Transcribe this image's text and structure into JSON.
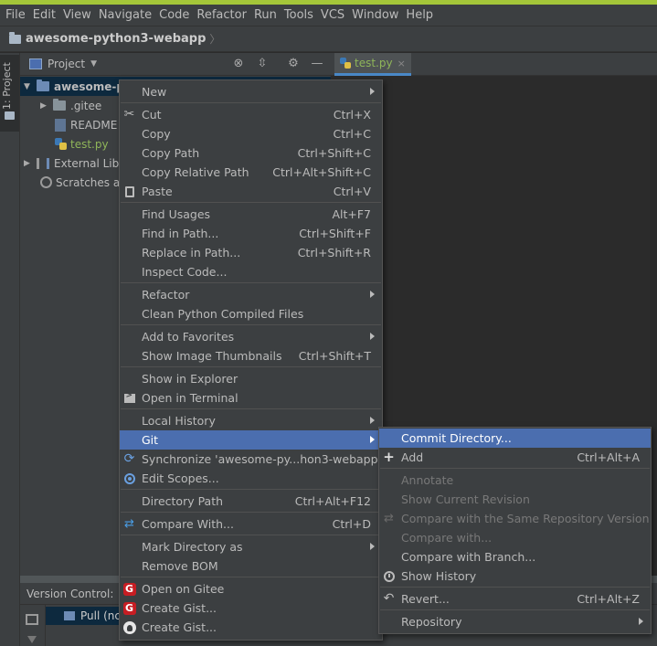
{
  "menubar": {
    "items": [
      "File",
      "Edit",
      "View",
      "Navigate",
      "Code",
      "Refactor",
      "Run",
      "Tools",
      "VCS",
      "Window",
      "Help"
    ]
  },
  "navbar": {
    "project_title": "awesome-python3-webapp",
    "chevron": "〉"
  },
  "toolstrip": {
    "project_label": "1: Project"
  },
  "project_panel": {
    "title": "Project",
    "tree": [
      {
        "label": "awesome-p",
        "indent": 0
      },
      {
        "label": ".gitee",
        "indent": 1
      },
      {
        "label": "README",
        "indent": 1
      },
      {
        "label": "test.py",
        "indent": 1
      },
      {
        "label": "External Libr",
        "indent": 0
      },
      {
        "label": "Scratches an",
        "indent": 0
      }
    ]
  },
  "editor": {
    "tab_label": "test.py",
    "tab_close": "×"
  },
  "version_control": {
    "title": "Version Control:",
    "pull_label": "Pull (nc"
  },
  "context_menu": {
    "items": [
      {
        "label": "New",
        "shortcut": "",
        "submenu": true
      },
      {
        "label": "Cut",
        "shortcut": "Ctrl+X",
        "icon": "scissors-icon"
      },
      {
        "label": "Copy",
        "shortcut": "Ctrl+C"
      },
      {
        "label": "Copy Path",
        "shortcut": "Ctrl+Shift+C"
      },
      {
        "label": "Copy Relative Path",
        "shortcut": "Ctrl+Alt+Shift+C"
      },
      {
        "label": "Paste",
        "shortcut": "Ctrl+V",
        "icon": "clipboard-icon"
      },
      {
        "label": "Find Usages",
        "shortcut": "Alt+F7"
      },
      {
        "label": "Find in Path...",
        "shortcut": "Ctrl+Shift+F"
      },
      {
        "label": "Replace in Path...",
        "shortcut": "Ctrl+Shift+R"
      },
      {
        "label": "Inspect Code...",
        "shortcut": ""
      },
      {
        "label": "Refactor",
        "shortcut": "",
        "submenu": true
      },
      {
        "label": "Clean Python Compiled Files",
        "shortcut": ""
      },
      {
        "label": "Add to Favorites",
        "shortcut": "",
        "submenu": true
      },
      {
        "label": "Show Image Thumbnails",
        "shortcut": "Ctrl+Shift+T"
      },
      {
        "label": "Show in Explorer",
        "shortcut": ""
      },
      {
        "label": "Open in Terminal",
        "shortcut": "",
        "icon": "terminal-icon"
      },
      {
        "label": "Local History",
        "shortcut": "",
        "submenu": true
      },
      {
        "label": "Git",
        "shortcut": "",
        "submenu": true,
        "selected": true
      },
      {
        "label": "Synchronize 'awesome-py...hon3-webapp'",
        "shortcut": "",
        "icon": "sync-icon"
      },
      {
        "label": "Edit Scopes...",
        "shortcut": "",
        "icon": "scope-icon"
      },
      {
        "label": "Directory Path",
        "shortcut": "Ctrl+Alt+F12"
      },
      {
        "label": "Compare With...",
        "shortcut": "Ctrl+D",
        "icon": "compare-icon"
      },
      {
        "label": "Mark Directory as",
        "shortcut": "",
        "submenu": true
      },
      {
        "label": "Remove BOM",
        "shortcut": ""
      },
      {
        "label": "Open on Gitee",
        "shortcut": "",
        "icon": "gitee-icon"
      },
      {
        "label": "Create Gist...",
        "shortcut": "",
        "icon": "gitee-icon"
      },
      {
        "label": "Create Gist...",
        "shortcut": "",
        "icon": "github-icon"
      }
    ]
  },
  "git_submenu": {
    "items": [
      {
        "label": "Commit Directory...",
        "shortcut": "",
        "selected": true
      },
      {
        "label": "Add",
        "shortcut": "Ctrl+Alt+A",
        "icon": "plus-icon"
      },
      {
        "label": "Annotate",
        "shortcut": "",
        "disabled": true
      },
      {
        "label": "Show Current Revision",
        "shortcut": "",
        "disabled": true
      },
      {
        "label": "Compare with the Same Repository Version",
        "shortcut": "",
        "disabled": true,
        "icon": "compare-icon"
      },
      {
        "label": "Compare with...",
        "shortcut": "",
        "disabled": true
      },
      {
        "label": "Compare with Branch...",
        "shortcut": ""
      },
      {
        "label": "Show History",
        "shortcut": "",
        "icon": "clock-icon"
      },
      {
        "label": "Revert...",
        "shortcut": "Ctrl+Alt+Z",
        "icon": "revert-icon"
      },
      {
        "label": "Repository",
        "shortcut": "",
        "submenu": true
      }
    ]
  },
  "colors": {
    "accent_bar": "#a4c639",
    "selection": "#4b6eaf",
    "menu_bg": "#3c3f41",
    "editor_bg": "#2b2b2b",
    "python_file": "#8fb559"
  }
}
